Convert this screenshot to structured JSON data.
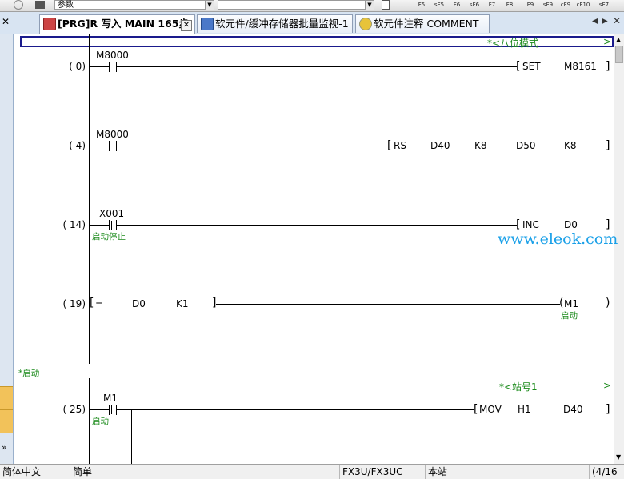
{
  "toolbar": {
    "combo_value": "参数",
    "function_keys": [
      "F5",
      "sF5",
      "F6",
      "sF6",
      "F7",
      "F8",
      "F9",
      "sF9",
      "cF9",
      "cF10",
      "sF7"
    ]
  },
  "tabs": [
    {
      "label": "[PRG]R 写入 MAIN 165步",
      "active": true
    },
    {
      "label": "软元件/缓冲存储器批量监视-1",
      "active": false
    },
    {
      "label": "软元件注释 COMMENT",
      "active": false
    }
  ],
  "editor": {
    "header_note": "*<八位模式",
    "header_note_arrow": ">",
    "rungs": [
      {
        "step": "(    0)",
        "contact": "M8000",
        "instruction": [
          "SET",
          "M8161"
        ]
      },
      {
        "step": "(    4)",
        "contact": "M8000",
        "instruction": [
          "RS",
          "D40",
          "K8",
          "D50",
          "K8"
        ]
      },
      {
        "step": "(   14)",
        "contact": "X001",
        "contact_comment": "启动停止",
        "instruction": [
          "INC",
          "D0"
        ]
      },
      {
        "step": "(   19)",
        "compare": [
          "=",
          "D0",
          "K1"
        ],
        "coil": "M1",
        "coil_comment": "启动"
      },
      {
        "step": "(   25)",
        "contact": "M1",
        "contact_comment": "启动",
        "instruction": [
          "MOV",
          "H1",
          "D40"
        ]
      }
    ],
    "statement_note": "*启动",
    "station_note": "*<站号1",
    "station_note_arrow": ">"
  },
  "watermark": "www.eleok.com",
  "statusbar": {
    "language": "简体中文",
    "mode": "简单",
    "plc": "FX3U/FX3UC",
    "station": "本站",
    "progress": "(4/16"
  },
  "colors": {
    "comment": "#1a8a1a",
    "watermark": "#1aa0e8",
    "cursor": "#1a1a8c",
    "tab_bg": "#d8e4f2"
  }
}
